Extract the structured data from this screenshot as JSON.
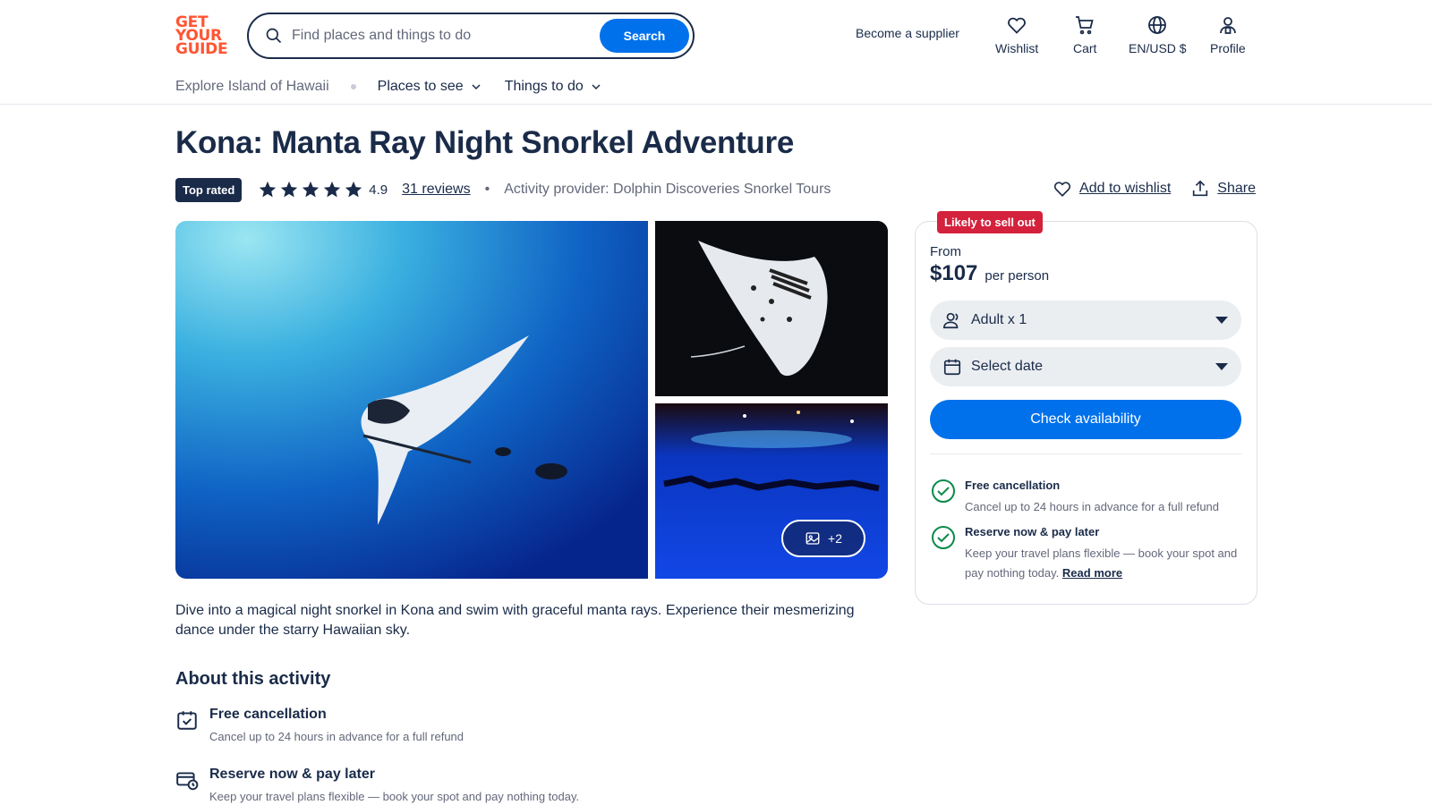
{
  "header": {
    "logo": [
      "GET",
      "YOUR",
      "GUIDE"
    ],
    "search_placeholder": "Find places and things to do",
    "search_button": "Search",
    "supplier": "Become a supplier",
    "nav": {
      "wishlist": "Wishlist",
      "cart": "Cart",
      "locale": "EN/USD $",
      "profile": "Profile"
    }
  },
  "subnav": {
    "explore": "Explore Island of Hawaii",
    "places": "Places to see",
    "things": "Things to do"
  },
  "activity": {
    "title": "Kona: Manta Ray Night Snorkel Adventure",
    "badge": "Top rated",
    "rating": "4.9",
    "stars": 5,
    "reviews": "31 reviews",
    "separator": "•",
    "provider": "Activity provider: Dolphin Discoveries Snorkel Tours",
    "wishlist_action": "Add to wishlist",
    "share_action": "Share",
    "more_photos": "+2",
    "description": "Dive into a magical night snorkel in Kona and swim with graceful manta rays. Experience their mesmerizing dance under the starry Hawaiian sky."
  },
  "about": {
    "heading": "About this activity",
    "items": [
      {
        "title": "Free cancellation",
        "detail": "Cancel up to 24 hours in advance for a full refund"
      },
      {
        "title": "Reserve now & pay later",
        "detail": "Keep your travel plans flexible — book your spot and pay nothing today."
      }
    ]
  },
  "booking": {
    "badge": "Likely to sell out",
    "from": "From",
    "price": "$107",
    "per": "per person",
    "participants": "Adult x 1",
    "date": "Select date",
    "cta": "Check availability",
    "perks": [
      {
        "title": "Free cancellation",
        "detail": "Cancel up to 24 hours in advance for a full refund"
      },
      {
        "title": "Reserve now & pay later",
        "detail": "Keep your travel plans flexible — book your spot and pay nothing today.",
        "link": "Read more"
      }
    ]
  },
  "colors": {
    "brand": "#ff5533",
    "primary": "#0071eb",
    "navy": "#1a2b49",
    "sellout": "#d4213c",
    "success": "#0a8a4a"
  }
}
